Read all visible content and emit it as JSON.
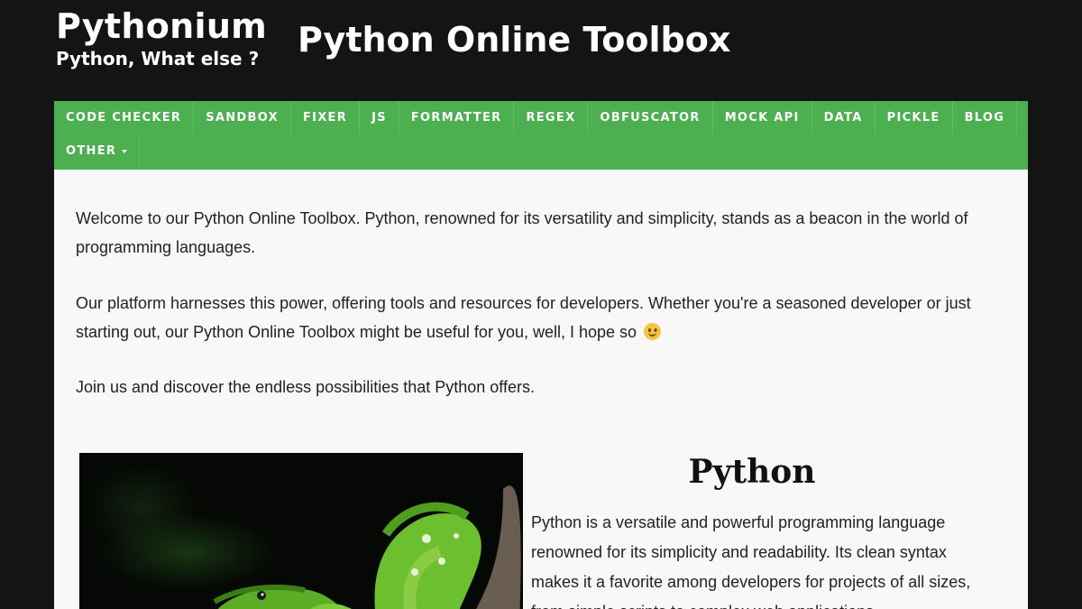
{
  "brand": {
    "name": "Pythonium",
    "tagline": "Python, What else ?"
  },
  "site_title": "Python Online Toolbox",
  "nav": {
    "items": [
      {
        "label": "CODE CHECKER"
      },
      {
        "label": "SANDBOX"
      },
      {
        "label": "FIXER"
      },
      {
        "label": "JS"
      },
      {
        "label": "FORMATTER"
      },
      {
        "label": "REGEX"
      },
      {
        "label": "OBFUSCATOR"
      },
      {
        "label": "MOCK API"
      },
      {
        "label": "DATA"
      },
      {
        "label": "PICKLE"
      },
      {
        "label": "BLOG"
      },
      {
        "label": "OTHER"
      }
    ]
  },
  "intro": {
    "p1": "Welcome to our Python Online Toolbox. Python, renowned for its versatility and simplicity, stands as a beacon in the world of programming languages.",
    "p2": "Our platform harnesses this power, offering tools and resources for developers. Whether you're a seasoned developer or just starting out, our Python Online Toolbox might be useful for you, well, I hope so",
    "p3": "Join us and discover the endless possibilities that Python offers."
  },
  "python_section": {
    "title": "Python",
    "text": "Python is a versatile and powerful programming language renowned for its simplicity and readability. Its clean syntax makes it a favorite among developers for projects of all sizes, from simple scripts to complex web applications."
  },
  "colors": {
    "header_bg": "#141414",
    "nav_bg": "#4caf50",
    "content_bg": "#f8f8f8"
  },
  "icons": {
    "emoji": "slightly-smiling-face-icon",
    "dropdown": "caret-down-icon"
  }
}
